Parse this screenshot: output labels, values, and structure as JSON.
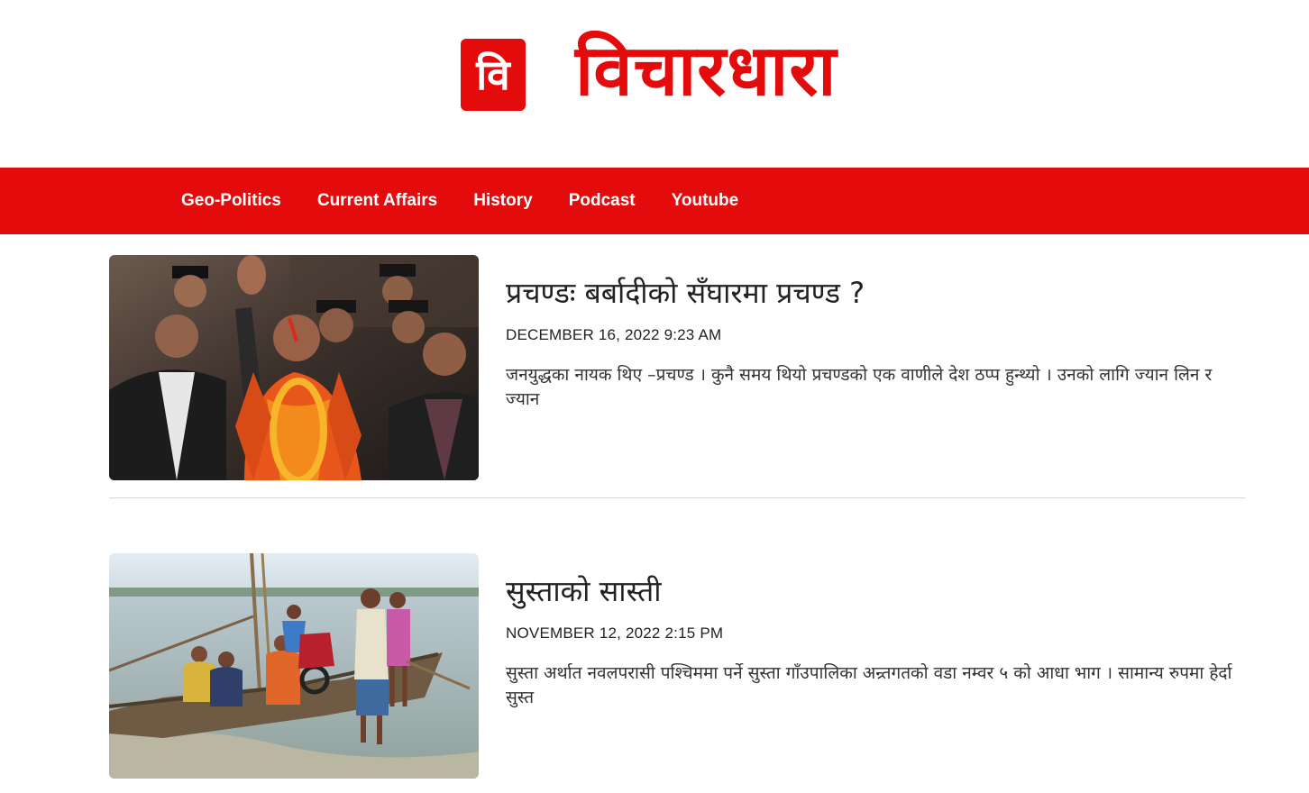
{
  "site": {
    "logo_glyph": "वि",
    "title": "विचारधारा",
    "brand_color": "#e40b0d"
  },
  "nav": {
    "items": [
      {
        "label": "Geo-Politics"
      },
      {
        "label": "Current Affairs"
      },
      {
        "label": "History"
      },
      {
        "label": "Podcast"
      },
      {
        "label": "Youtube"
      }
    ]
  },
  "articles": [
    {
      "title": "प्रचण्डः बर्बादीको सँघारमा प्रचण्ड ?",
      "date": "DECEMBER 16, 2022 9:23 AM",
      "excerpt": "जनयुद्धका नायक थिए –प्रचण्ड । कुनै समय थियो प्रचण्डको एक वाणीले देश ठप्प हुन्थ्यो । उनको लागि ज्यान लिन र ज्यान",
      "image": "photo of a politician waving with garlands surrounded by men in caps"
    },
    {
      "title": "सुस्ताको सास्ती",
      "date": "NOVEMBER 12, 2022 2:15 PM",
      "excerpt": "सुस्ता अर्थात नवलपरासी पश्चिममा पर्ने सुस्ता गाँउपालिका अन्र्तगतको वडा नम्वर ५ को आधा भाग । सामान्य रुपमा हेर्दा सुस्त",
      "image": "photo of people and a motorcycle on a wooden boat on a river"
    }
  ]
}
